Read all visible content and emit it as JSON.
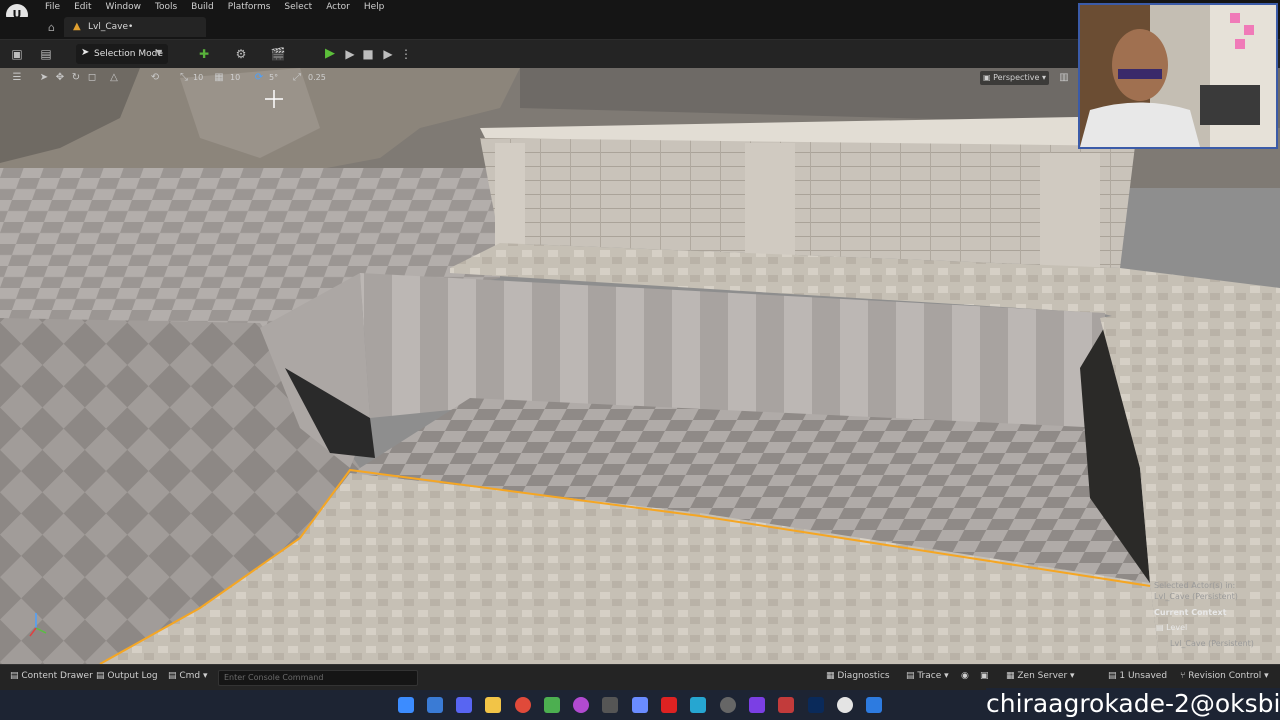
{
  "menubar": {
    "logo": "U",
    "items": [
      "File",
      "Edit",
      "Window",
      "Tools",
      "Build",
      "Platforms",
      "Select",
      "Actor",
      "Help"
    ]
  },
  "tabs": {
    "level_tab": "Lvl_Cave•"
  },
  "toolbar": {
    "mode_label": "Selection Mode"
  },
  "viewport_toolbar": {
    "grid_snap": "10",
    "rotate_snap": "5°",
    "scale_snap": "0.25",
    "view_mode": "Perspective"
  },
  "context": {
    "selected_line": "Selected Actor(s) in:",
    "selected_level": "Lvl_Cave (Persistent)",
    "current_context_label": "Current Context",
    "level_label": "Level",
    "level_value": "Lvl_Cave (Persistent)"
  },
  "statusbar": {
    "content_drawer": "Content Drawer",
    "output_log": "Output Log",
    "cmd": "Cmd",
    "console_placeholder": "Enter Console Command",
    "diagnostics": "Diagnostics",
    "trace": "Trace",
    "zen_server": "Zen Server",
    "unsaved": "1 Unsaved",
    "revision_control": "Revision Control"
  },
  "watermark": "chiraagrokade-2@oksbi",
  "colors": {
    "selection_outline": "#f5a623",
    "play_green": "#5cbf3a",
    "accent_blue": "#3b5ba8"
  }
}
